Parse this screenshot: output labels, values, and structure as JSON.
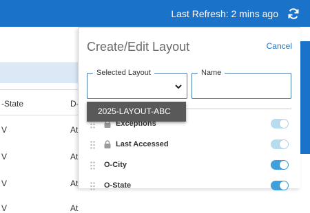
{
  "header": {
    "last_refresh": "Last Refresh: 2 mins ago",
    "refresh_icon": "refresh-icon",
    "brand_color": "#1a73c9"
  },
  "background_table": {
    "columns": [
      "-State",
      "D-"
    ],
    "rows": [
      [
        "V",
        "At"
      ],
      [
        "V",
        "At"
      ],
      [
        "V",
        "At"
      ],
      [
        "V",
        "At"
      ]
    ]
  },
  "panel": {
    "title": "Create/Edit Layout",
    "cancel_label": "Cancel",
    "selected_layout": {
      "legend": "Selected Layout",
      "value": "",
      "option": "2025-LAYOUT-ABC"
    },
    "name_field": {
      "legend": "Name",
      "value": ""
    },
    "fields": [
      {
        "label": "Exceptions",
        "locked": true,
        "enabled": true,
        "toggle_color": "#b7dcf0"
      },
      {
        "label": "Last Accessed",
        "locked": true,
        "enabled": true,
        "toggle_color": "#b7dcf0"
      },
      {
        "label": "O-City",
        "locked": false,
        "enabled": true,
        "toggle_color": "#3d9fdb"
      },
      {
        "label": "O-State",
        "locked": false,
        "enabled": true,
        "toggle_color": "#3d9fdb"
      }
    ]
  }
}
